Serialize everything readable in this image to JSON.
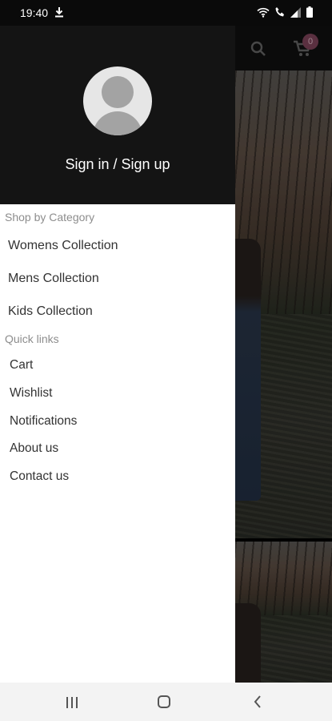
{
  "status_bar": {
    "time": "19:40",
    "icons": [
      "download-icon",
      "wifi-icon",
      "volte-call-icon",
      "signal-icon",
      "battery-icon"
    ]
  },
  "toolbar": {
    "icons": [
      "search-icon",
      "cart-icon"
    ],
    "cart_count": "0"
  },
  "drawer": {
    "avatar_icon": "user-avatar-icon",
    "sign_in_label": "Sign in / Sign up",
    "shop_by_category": {
      "title": "Shop by Category",
      "items": [
        {
          "label": "Womens Collection"
        },
        {
          "label": "Mens Collection"
        },
        {
          "label": "Kids Collection"
        }
      ]
    },
    "quick_links": {
      "title": "Quick links",
      "items": [
        {
          "label": "Cart"
        },
        {
          "label": "Wishlist"
        },
        {
          "label": "Notifications"
        },
        {
          "label": "About us"
        },
        {
          "label": "Contact us"
        }
      ]
    }
  },
  "nav_bar": {
    "icons": [
      "recent-apps-icon",
      "home-icon",
      "back-icon"
    ]
  },
  "colors": {
    "drawer_header": "#141414",
    "cart_badge": "#8a4a63",
    "section_title": "#8d8d8d"
  }
}
